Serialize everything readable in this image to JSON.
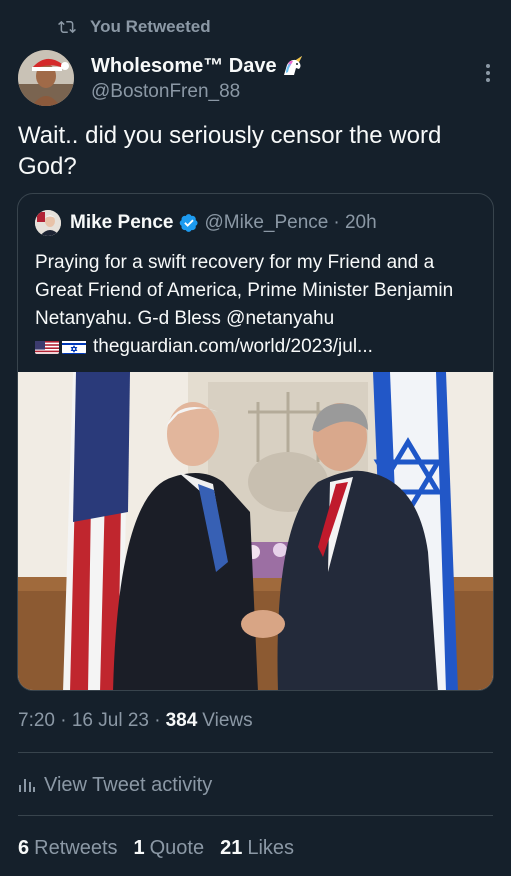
{
  "retweet_context": {
    "label": "You Retweeted",
    "icon": "retweet-icon"
  },
  "tweet": {
    "author": {
      "display_name": "Wholesome™ Dave",
      "handle": "@BostonFren_88",
      "emoji": "unicorn-icon"
    },
    "text": "Wait..  did you seriously censor the word God?",
    "timestamp": "7:20 · 16 Jul 23 ·",
    "views_count": "384",
    "views_label": "Views",
    "activity_label": "View Tweet activity",
    "stats": {
      "retweets": {
        "count": "6",
        "label": "Retweets"
      },
      "quotes": {
        "count": "1",
        "label": "Quote"
      },
      "likes": {
        "count": "21",
        "label": "Likes"
      }
    }
  },
  "quoted_tweet": {
    "author": {
      "display_name": "Mike Pence",
      "handle": "@Mike_Pence",
      "time": "· 20h",
      "verified": true
    },
    "text": "Praying for a swift recovery for my Friend and a Great Friend of America, Prime Minister Benjamin Netanyahu. G-d Bless @netanyahu",
    "link": "theguardian.com/world/2023/jul...",
    "flags": [
      "us-flag-icon",
      "israel-flag-icon"
    ]
  },
  "colors": {
    "background": "#15202b",
    "text": "#f7f9f9",
    "muted": "#8b98a5",
    "border": "#38444d",
    "verified": "#1d9bf0"
  }
}
